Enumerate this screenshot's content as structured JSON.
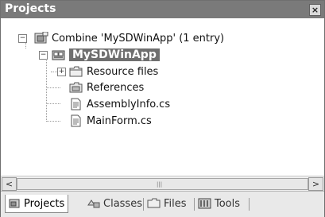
{
  "panel": {
    "title": "Projects",
    "close_glyph": "×"
  },
  "tree": {
    "items": [
      {
        "label": "Combine 'MySDWinApp' (1 entry)",
        "icon": "combine-icon",
        "expander": "−"
      },
      {
        "label": "MySDWinApp",
        "icon": "project-icon",
        "expander": "−",
        "selected": true
      },
      {
        "label": "Resource files",
        "icon": "folder-icon",
        "expander": "+"
      },
      {
        "label": "References",
        "icon": "references-folder-icon"
      },
      {
        "label": "AssemblyInfo.cs",
        "icon": "file-icon"
      },
      {
        "label": "MainForm.cs",
        "icon": "file-icon"
      }
    ]
  },
  "scrollbar": {
    "left_arrow": "<",
    "right_arrow": ">"
  },
  "tabs": [
    {
      "label": "Projects",
      "icon": "projects-tab-icon",
      "active": true
    },
    {
      "label": "Classes",
      "icon": "classes-tab-icon"
    },
    {
      "label": "Files",
      "icon": "files-tab-icon"
    },
    {
      "label": "Tools",
      "icon": "tools-tab-icon"
    }
  ]
}
